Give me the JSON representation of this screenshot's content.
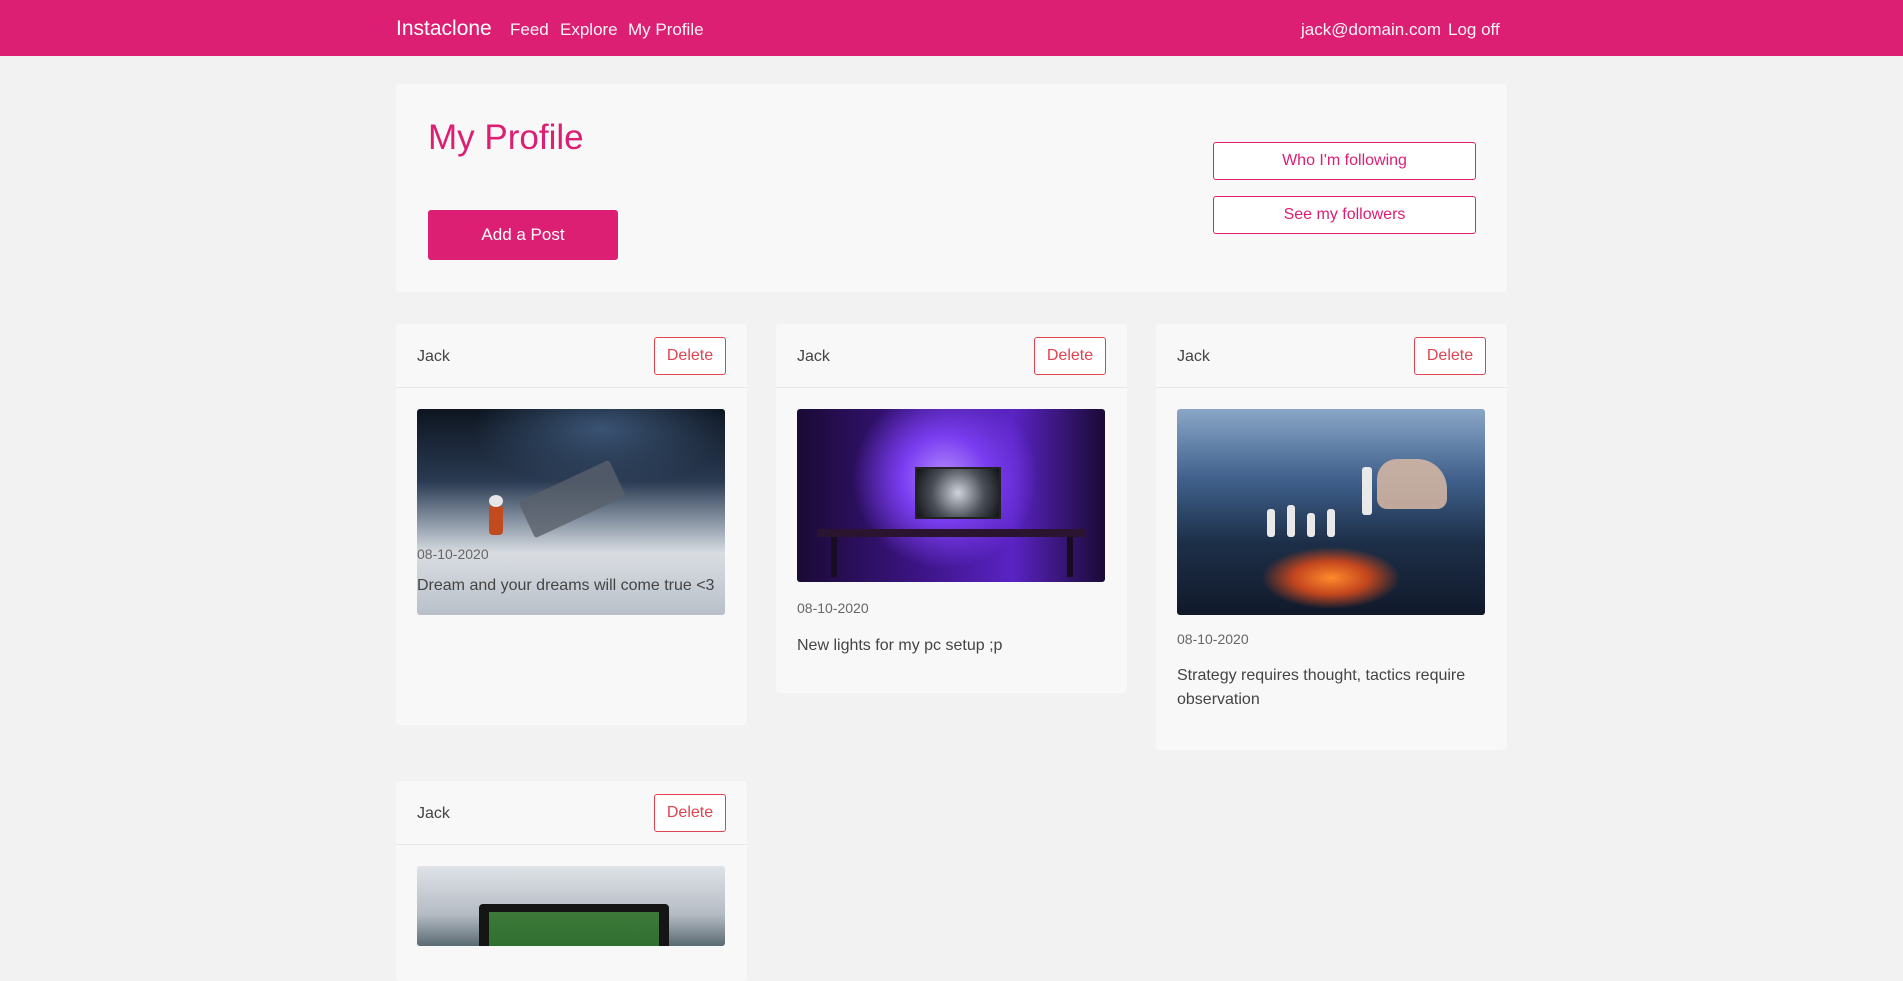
{
  "navbar": {
    "brand": "Instaclone",
    "links": {
      "feed": "Feed",
      "explore": "Explore",
      "profile": "My Profile"
    },
    "email": "jack@domain.com",
    "logoff": "Log off",
    "color": "#dc1f73"
  },
  "profile": {
    "title": "My Profile",
    "add_post": "Add a Post",
    "following": "Who I'm following",
    "followers": "See my followers"
  },
  "posts": [
    {
      "user": "Jack",
      "delete": "Delete",
      "date": "08-10-2020",
      "caption": "Dream and your dreams will come true <3",
      "image": "lego-astronaut-moon"
    },
    {
      "user": "Jack",
      "delete": "Delete",
      "date": "08-10-2020",
      "caption": "New lights for my pc setup ;p",
      "image": "purple-pc-setup"
    },
    {
      "user": "Jack",
      "delete": "Delete",
      "date": "08-10-2020",
      "caption": "Strategy requires thought, tactics require observation",
      "image": "chess-board"
    },
    {
      "user": "Jack",
      "delete": "Delete",
      "image": "soccer-tv-screen"
    }
  ]
}
